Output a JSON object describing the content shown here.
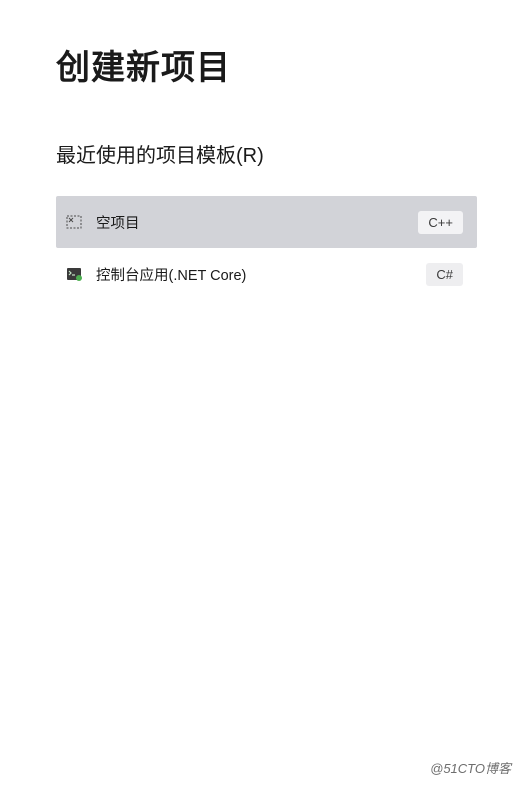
{
  "page": {
    "title": "创建新项目",
    "section_title": "最近使用的项目模板(R)"
  },
  "templates": [
    {
      "icon": "empty-project-icon",
      "label": "空项目",
      "language": "C++",
      "selected": true
    },
    {
      "icon": "console-app-icon",
      "label": "控制台应用(.NET Core)",
      "language": "C#",
      "selected": false
    }
  ],
  "watermark": "@51CTO博客"
}
